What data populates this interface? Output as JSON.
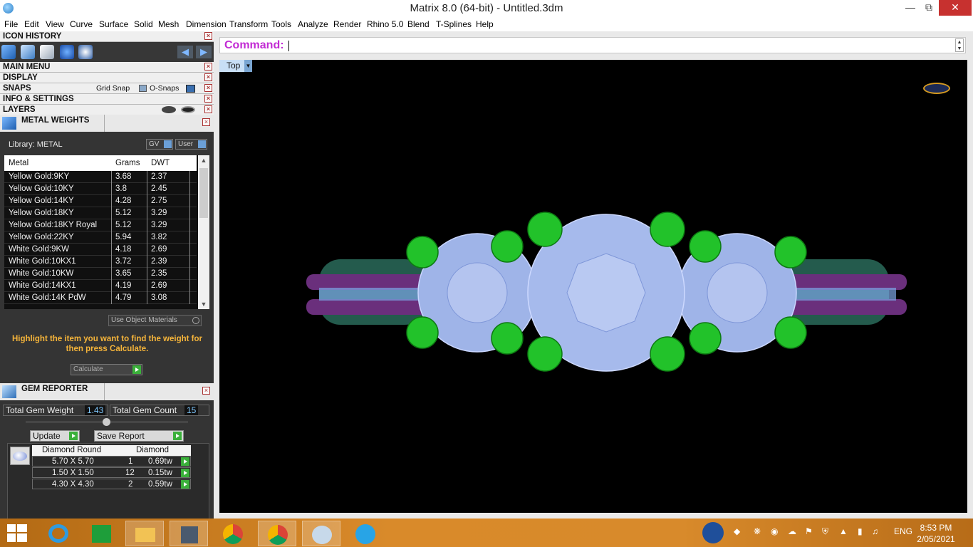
{
  "window": {
    "title": "Matrix 8.0 (64-bit) - Untitled.3dm"
  },
  "menu": [
    "File",
    "Edit",
    "View",
    "Curve",
    "Surface",
    "Solid",
    "Mesh",
    "Dimension",
    "Transform",
    "Tools",
    "Analyze",
    "Render",
    "Rhino 5.0",
    "Blend",
    "T-Splines",
    "Help"
  ],
  "panels": {
    "icon_history": "ICON HISTORY",
    "main_menu": "MAIN MENU",
    "display": "DISPLAY",
    "snaps": "SNAPS",
    "grid_snap": "Grid Snap",
    "o_snaps": "O-Snaps",
    "info_settings": "INFO & SETTINGS",
    "layers": "LAYERS"
  },
  "metal_weights": {
    "title": "METAL WEIGHTS",
    "library": "Library: METAL",
    "gv": "GV",
    "user": "User",
    "columns": [
      "Metal",
      "Grams",
      "DWT"
    ],
    "rows": [
      [
        "Yellow Gold:9KY",
        "3.68",
        "2.37"
      ],
      [
        "Yellow Gold:10KY",
        "3.8",
        "2.45"
      ],
      [
        "Yellow Gold:14KY",
        "4.28",
        "2.75"
      ],
      [
        "Yellow Gold:18KY",
        "5.12",
        "3.29"
      ],
      [
        "Yellow Gold:18KY Royal",
        "5.12",
        "3.29"
      ],
      [
        "Yellow Gold:22KY",
        "5.94",
        "3.82"
      ],
      [
        "White Gold:9KW",
        "4.18",
        "2.69"
      ],
      [
        "White Gold:10KX1",
        "3.72",
        "2.39"
      ],
      [
        "White Gold:10KW",
        "3.65",
        "2.35"
      ],
      [
        "White Gold:14KX1",
        "4.19",
        "2.69"
      ],
      [
        "White Gold:14K PdW",
        "4.79",
        "3.08"
      ]
    ],
    "use_object_materials": "Use Object Materials",
    "hint": "Highlight the item you want to find the weight for then press Calculate.",
    "calculate": "Calculate"
  },
  "gem_reporter": {
    "title": "GEM REPORTER",
    "total_weight_label": "Total Gem Weight",
    "total_weight": "1.43",
    "total_count_label": "Total Gem Count",
    "total_count": "15",
    "update": "Update",
    "save_report": "Save Report",
    "head_shape": "Diamond Round",
    "head_material": "Diamond",
    "rows": [
      [
        "5.70 X 5.70",
        "1",
        "0.69tw"
      ],
      [
        "1.50 X 1.50",
        "12",
        "0.15tw"
      ],
      [
        "4.30 X 4.30",
        "2",
        "0.59tw"
      ]
    ]
  },
  "command": {
    "label": "Command:"
  },
  "viewport": {
    "label": "Top"
  },
  "taskbar": {
    "lang": "ENG",
    "time": "8:53 PM",
    "date": "2/05/2021"
  }
}
